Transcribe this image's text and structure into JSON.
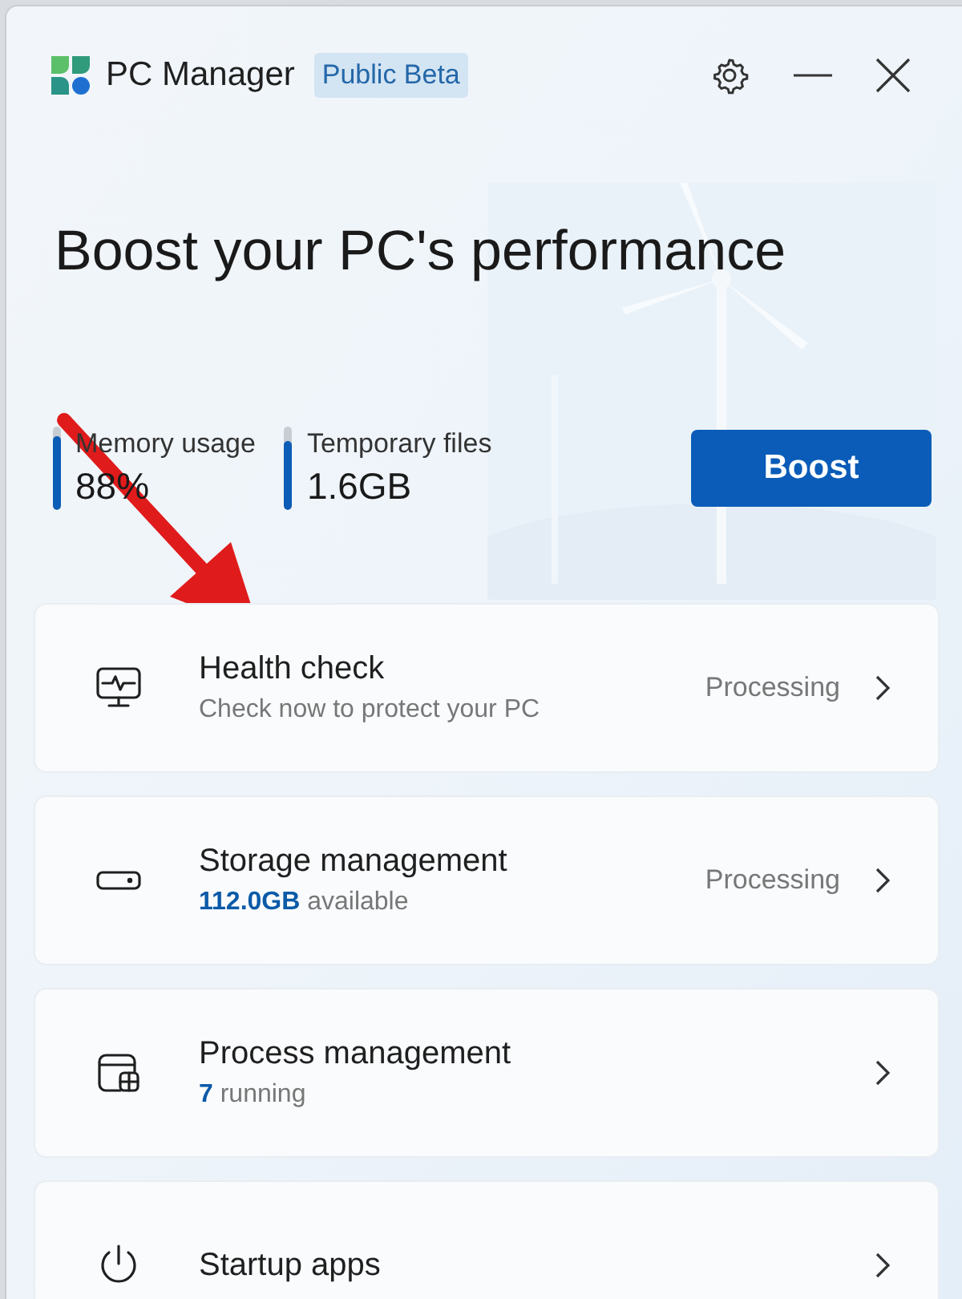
{
  "window": {
    "app_name": "PC Manager",
    "badge": "Public Beta"
  },
  "heading": "Boost your PC's performance",
  "meters": [
    {
      "label": "Memory usage",
      "value": "88%",
      "level": 0.88
    },
    {
      "label": "Temporary files",
      "value": "1.6GB",
      "level": 0.82
    }
  ],
  "boost_button": "Boost",
  "cards": [
    {
      "title": "Health check",
      "subtitle": "Check now to protect your PC",
      "status": "Processing"
    },
    {
      "title": "Storage management",
      "subtitle": "**112.0GB** available",
      "status": "Processing"
    },
    {
      "title": "Process management",
      "subtitle": "**7** running"
    },
    {
      "title": "Startup apps"
    }
  ]
}
